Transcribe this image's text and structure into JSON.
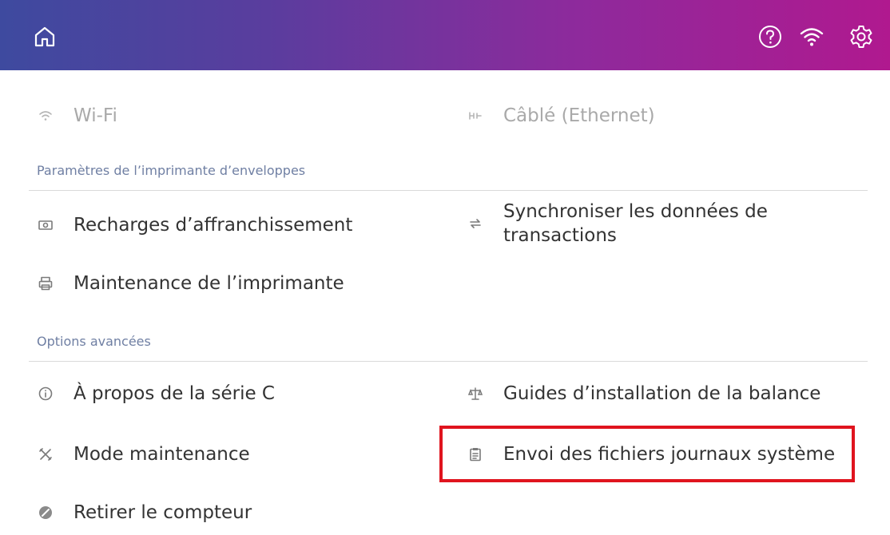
{
  "header": {
    "home_icon": "home-icon",
    "help_icon": "help-circle-icon",
    "wifi_icon": "wifi-icon",
    "settings_icon": "gear-icon"
  },
  "network": {
    "wifi_label": "Wi-Fi",
    "ethernet_label": "Câblé (Ethernet)"
  },
  "printer_settings": {
    "title": "Paramètres de l’imprimante d’enveloppes",
    "postage_refills": "Recharges d’affranchissement",
    "sync_transactions": "Synchroniser les données de transactions",
    "printer_maintenance": "Maintenance de l’imprimante"
  },
  "advanced": {
    "title": "Options avancées",
    "about": "À propos de la série C",
    "scale_guides": "Guides d’installation de la balance",
    "maintenance_mode": "Mode maintenance",
    "send_logs": "Envoi des fichiers journaux système",
    "remove_meter": "Retirer le compteur"
  },
  "colors": {
    "header_gradient_start": "#3e4a9f",
    "header_gradient_end": "#b0198f",
    "highlight_border": "#e0141e",
    "section_title": "#6f7fa3"
  }
}
